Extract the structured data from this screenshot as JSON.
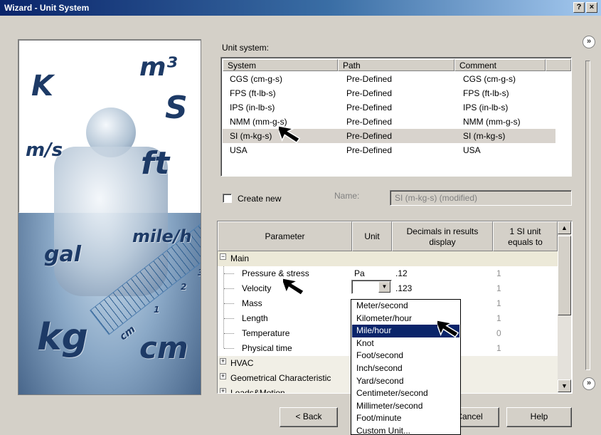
{
  "window": {
    "title": "Wizard - Unit System",
    "help_btn": "?",
    "close_btn": "×"
  },
  "illustration": {
    "units": [
      "K",
      "m³",
      "S",
      "m/s",
      "ft",
      "mile/h",
      "gal",
      "kg",
      "cm"
    ],
    "ruler_marks": [
      "cm",
      "1",
      "2",
      "3"
    ]
  },
  "unit_system": {
    "label": "Unit system:",
    "columns": [
      "System",
      "Path",
      "Comment"
    ],
    "rows": [
      {
        "system": "CGS (cm-g-s)",
        "path": "Pre-Defined",
        "comment": "CGS (cm-g-s)"
      },
      {
        "system": "FPS (ft-lb-s)",
        "path": "Pre-Defined",
        "comment": "FPS (ft-lb-s)"
      },
      {
        "system": "IPS (in-lb-s)",
        "path": "Pre-Defined",
        "comment": "IPS (in-lb-s)"
      },
      {
        "system": "NMM (mm-g-s)",
        "path": "Pre-Defined",
        "comment": "NMM (mm-g-s)"
      },
      {
        "system": "SI (m-kg-s)",
        "path": "Pre-Defined",
        "comment": "SI (m-kg-s)"
      },
      {
        "system": "USA",
        "path": "Pre-Defined",
        "comment": "USA"
      }
    ]
  },
  "create_new": {
    "label": "Create new",
    "name_label": "Name:",
    "name_value": "SI (m-kg-s) (modified)"
  },
  "params": {
    "columns": [
      "Parameter",
      "Unit",
      "Decimals in results display",
      "1 SI unit equals to"
    ],
    "group_main": "Main",
    "rows": [
      {
        "name": "Pressure & stress",
        "unit": "Pa",
        "decimals": ".12",
        "equals": "1"
      },
      {
        "name": "Velocity",
        "unit": "",
        "decimals": ".123",
        "equals": "1"
      },
      {
        "name": "Mass",
        "unit": "",
        "decimals": "",
        "equals": "1"
      },
      {
        "name": "Length",
        "unit": "",
        "decimals": "",
        "equals": "1"
      },
      {
        "name": "Temperature",
        "unit": "",
        "decimals": "",
        "equals": "0"
      },
      {
        "name": "Physical time",
        "unit": "",
        "decimals": "",
        "equals": "1"
      }
    ],
    "groups_collapsed": [
      "HVAC",
      "Geometrical Characteristic",
      "Loads&Motion"
    ]
  },
  "velocity_options": [
    "Meter/second",
    "Kilometer/hour",
    "Mile/hour",
    "Knot",
    "Foot/second",
    "Inch/second",
    "Yard/second",
    "Centimeter/second",
    "Millimeter/second",
    "Foot/minute",
    "Custom Unit..."
  ],
  "buttons": {
    "back": "< Back",
    "cancel": "Cancel",
    "help": "Help",
    "collapse": "»",
    "expand": "»"
  },
  "colors": {
    "titlebar": "#0a246a",
    "selection": "#0a246a",
    "selected_row": "#d8d3cd",
    "dialog": "#d4d0c8"
  }
}
